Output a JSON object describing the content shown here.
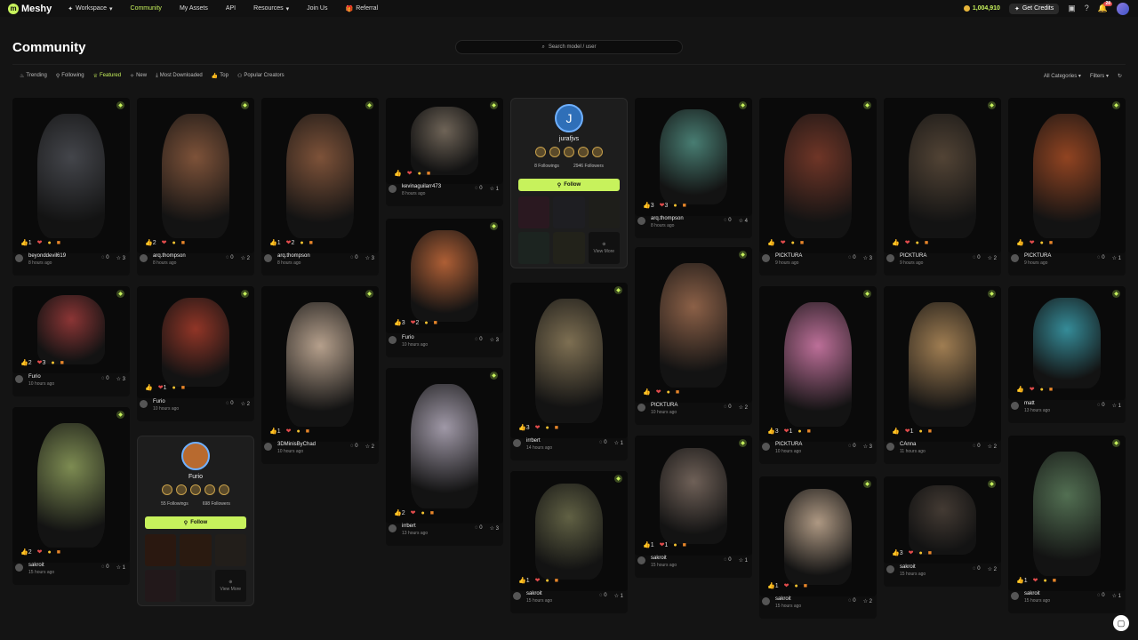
{
  "nav": {
    "logo": "Meshy",
    "workspace": "Workspace",
    "community": "Community",
    "my_assets": "My Assets",
    "api": "API",
    "resources": "Resources",
    "join_us": "Join Us",
    "referral": "Referral",
    "credits": "1,004,910",
    "get_credits": "Get Credits",
    "notif_count": "28"
  },
  "page": {
    "title": "Community",
    "search_placeholder": "Search model / user"
  },
  "filters": {
    "trending": "Trending",
    "following": "Following",
    "featured": "Featured",
    "new": "New",
    "most_downloaded": "Most Downloaded",
    "top": "Top",
    "popular_creators": "Popular Creators",
    "all_categories": "All Categories",
    "filters": "Filters"
  },
  "accent": "#c7f25c",
  "cards": [
    {
      "user": "beyonddevil619",
      "time": "8 hours ago",
      "likes": "0",
      "stars": "3",
      "reacts": [
        "1",
        "",
        ""
      ]
    },
    {
      "user": "arq.thompson",
      "time": "8 hours ago",
      "likes": "0",
      "stars": "2",
      "reacts": [
        "2",
        "",
        ""
      ]
    },
    {
      "user": "arq.thompson",
      "time": "8 hours ago",
      "likes": "0",
      "stars": "3",
      "reacts": [
        "1",
        "2",
        ""
      ]
    },
    {
      "user": "kevinaguilarr473",
      "time": "8 hours ago",
      "likes": "0",
      "stars": "1",
      "reacts": [
        "",
        "",
        ""
      ]
    },
    {
      "user": "arq.thompson",
      "time": "8 hours ago",
      "likes": "0",
      "stars": "4",
      "reacts": [
        "3",
        "3",
        ""
      ]
    },
    {
      "user": "PICKTURA",
      "time": "9 hours ago",
      "likes": "0",
      "stars": "3",
      "reacts": [
        "",
        "",
        ""
      ]
    },
    {
      "user": "PICKTURA",
      "time": "9 hours ago",
      "likes": "0",
      "stars": "2",
      "reacts": [
        "",
        "",
        ""
      ]
    },
    {
      "user": "PICKTURA",
      "time": "9 hours ago",
      "likes": "0",
      "stars": "1",
      "reacts": [
        "",
        "",
        ""
      ]
    },
    {
      "user": "Furio",
      "time": "10 hours ago",
      "likes": "0",
      "stars": "3",
      "reacts": [
        "2",
        "3",
        ""
      ]
    },
    {
      "user": "Furio",
      "time": "10 hours ago",
      "likes": "0",
      "stars": "2",
      "reacts": [
        "",
        "1",
        ""
      ]
    },
    {
      "user": "3DMinisByChad",
      "time": "10 hours ago",
      "likes": "0",
      "stars": "2",
      "reacts": [
        "1",
        "",
        ""
      ]
    },
    {
      "user": "Furio",
      "time": "10 hours ago",
      "likes": "0",
      "stars": "3",
      "reacts": [
        "3",
        "2",
        ""
      ]
    },
    {
      "user": "PICKTURA",
      "time": "10 hours ago",
      "likes": "0",
      "stars": "2",
      "reacts": [
        "",
        "",
        ""
      ]
    },
    {
      "user": "PICKTURA",
      "time": "10 hours ago",
      "likes": "0",
      "stars": "3",
      "reacts": [
        "3",
        "1",
        ""
      ]
    },
    {
      "user": "CAnna",
      "time": "11 hours ago",
      "likes": "0",
      "stars": "2",
      "reacts": [
        "",
        "1",
        ""
      ]
    },
    {
      "user": "matt",
      "time": "13 hours ago",
      "likes": "0",
      "stars": "1",
      "reacts": [
        "",
        "",
        ""
      ]
    },
    {
      "user": "irrbert",
      "time": "13 hours ago",
      "likes": "0",
      "stars": "3",
      "reacts": [
        "2",
        "",
        ""
      ]
    },
    {
      "user": "irrbert",
      "time": "14 hours ago",
      "likes": "0",
      "stars": "1",
      "reacts": [
        "3",
        "",
        ""
      ]
    },
    {
      "user": "sakroit",
      "time": "15 hours ago",
      "likes": "0",
      "stars": "1",
      "reacts": [
        "2",
        "",
        ""
      ]
    },
    {
      "user": "sakroit",
      "time": "15 hours ago",
      "likes": "0",
      "stars": "1",
      "reacts": [
        "1",
        "",
        ""
      ]
    },
    {
      "user": "sakroit",
      "time": "15 hours ago",
      "likes": "0",
      "stars": "1",
      "reacts": [
        "1",
        "1",
        ""
      ]
    },
    {
      "user": "sakroit",
      "time": "15 hours ago",
      "likes": "0",
      "stars": "2",
      "reacts": [
        "1",
        "",
        ""
      ]
    },
    {
      "user": "sakroit",
      "time": "15 hours ago",
      "likes": "0",
      "stars": "2",
      "reacts": [
        "3",
        "",
        ""
      ]
    },
    {
      "user": "sakroit",
      "time": "15 hours ago",
      "likes": "0",
      "stars": "1",
      "reacts": [
        "1",
        "",
        ""
      ]
    }
  ],
  "creators": [
    {
      "name": "jurafjvs",
      "initial": "J",
      "followings": "8 Followings",
      "followers": "2946 Followers",
      "follow": "Follow",
      "view_more": "View More"
    },
    {
      "name": "Furio",
      "initial": "",
      "followings": "55 Followings",
      "followers": "698 Followers",
      "follow": "Follow",
      "view_more": "View More"
    }
  ],
  "icons": {
    "heart": "heart-icon",
    "star": "star-icon",
    "gem": "gem-icon"
  }
}
